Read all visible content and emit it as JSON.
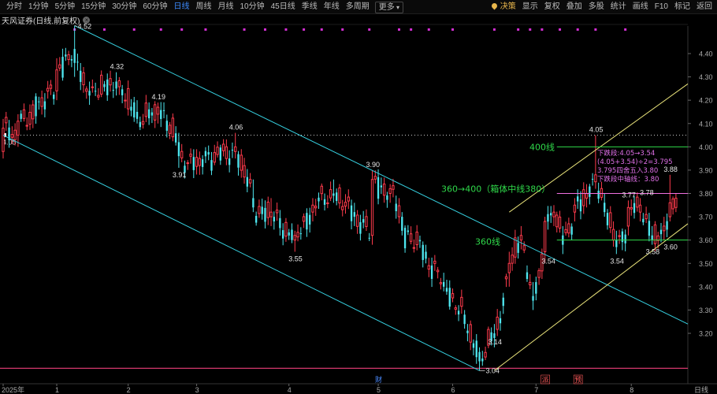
{
  "toolbar": {
    "periods": [
      "分时",
      "1分钟",
      "5分钟",
      "15分钟",
      "30分钟",
      "60分钟",
      "日线",
      "周线",
      "月线",
      "10分钟",
      "45日线",
      "季线",
      "年线",
      "多周期"
    ],
    "active_period": "日线",
    "more_label": "更多",
    "more_icon": "chevron-down-icon",
    "tools": [
      "决策",
      "显示",
      "复权",
      "叠加",
      "多股",
      "统计",
      "画线",
      "F10",
      "标记",
      "返回"
    ],
    "accent_color": "#e8b64c",
    "active_color": "#3d8bff"
  },
  "stock_title": "天风证券(日线,前复权)",
  "chart_data": {
    "type": "candlestick",
    "title": "天风证券(日线,前复权)",
    "ylim": [
      3.04,
      4.5
    ],
    "y_ticks": [
      4.4,
      4.3,
      4.2,
      4.1,
      4.0,
      3.9,
      3.8,
      3.7,
      3.6,
      3.5,
      3.4,
      3.3,
      3.2
    ],
    "x_ticks": [
      {
        "label": "2025年",
        "day": 0
      },
      {
        "label": "1",
        "day": 18
      },
      {
        "label": "2",
        "day": 42
      },
      {
        "label": "3",
        "day": 65
      },
      {
        "label": "4",
        "day": 96
      },
      {
        "label": "5",
        "day": 126
      },
      {
        "label": "6",
        "day": 151
      },
      {
        "label": "7",
        "day": 179
      },
      {
        "label": "8",
        "day": 211
      }
    ],
    "x_range_days": [
      0,
      230
    ],
    "right_axis_label": "日线",
    "up_color": "#ff3b4c",
    "down_color": "#4ee6ef",
    "anchors": [
      {
        "day": 0,
        "open": 3.98,
        "high": 4.12,
        "low": 3.95,
        "close": 4.08
      },
      {
        "day": 5,
        "open": 4.05,
        "high": 4.14,
        "low": 4.0,
        "close": 4.11
      },
      {
        "day": 10,
        "open": 4.12,
        "high": 4.2,
        "low": 4.08,
        "close": 4.18
      },
      {
        "day": 18,
        "open": 4.24,
        "high": 4.38,
        "low": 4.2,
        "close": 4.33
      },
      {
        "day": 24,
        "open": 4.42,
        "high": 4.52,
        "low": 4.3,
        "close": 4.36
      },
      {
        "day": 29,
        "open": 4.24,
        "high": 4.28,
        "low": 4.18,
        "close": 4.22
      },
      {
        "day": 38,
        "open": 4.28,
        "high": 4.32,
        "low": 4.22,
        "close": 4.25
      },
      {
        "day": 45,
        "open": 4.15,
        "high": 4.2,
        "low": 4.1,
        "close": 4.12
      },
      {
        "day": 52,
        "open": 4.14,
        "high": 4.19,
        "low": 4.1,
        "close": 4.17
      },
      {
        "day": 59,
        "open": 4.02,
        "high": 4.06,
        "low": 3.91,
        "close": 3.96
      },
      {
        "day": 66,
        "open": 3.92,
        "high": 3.98,
        "low": 3.88,
        "close": 3.95
      },
      {
        "day": 78,
        "open": 3.98,
        "high": 4.06,
        "low": 3.95,
        "close": 4.0
      },
      {
        "day": 84,
        "open": 3.78,
        "high": 3.86,
        "low": 3.72,
        "close": 3.74
      },
      {
        "day": 90,
        "open": 3.7,
        "high": 3.78,
        "low": 3.66,
        "close": 3.72
      },
      {
        "day": 98,
        "open": 3.6,
        "high": 3.64,
        "low": 3.55,
        "close": 3.62
      },
      {
        "day": 104,
        "open": 3.72,
        "high": 3.78,
        "low": 3.68,
        "close": 3.75
      },
      {
        "day": 111,
        "open": 3.8,
        "high": 3.86,
        "low": 3.76,
        "close": 3.79
      },
      {
        "day": 118,
        "open": 3.72,
        "high": 3.76,
        "low": 3.66,
        "close": 3.7
      },
      {
        "day": 124,
        "open": 3.62,
        "high": 3.9,
        "low": 3.58,
        "close": 3.86
      },
      {
        "day": 130,
        "open": 3.8,
        "high": 3.84,
        "low": 3.76,
        "close": 3.82
      },
      {
        "day": 134,
        "open": 3.7,
        "high": 3.72,
        "low": 3.62,
        "close": 3.64
      },
      {
        "day": 142,
        "open": 3.55,
        "high": 3.58,
        "low": 3.5,
        "close": 3.52
      },
      {
        "day": 148,
        "open": 3.42,
        "high": 3.46,
        "low": 3.38,
        "close": 3.4
      },
      {
        "day": 155,
        "open": 3.28,
        "high": 3.3,
        "low": 3.22,
        "close": 3.24
      },
      {
        "day": 160,
        "open": 3.12,
        "high": 3.14,
        "low": 3.04,
        "close": 3.08
      },
      {
        "day": 165,
        "open": 3.2,
        "high": 3.24,
        "low": 3.14,
        "close": 3.18
      },
      {
        "day": 170,
        "open": 3.46,
        "high": 3.55,
        "low": 3.4,
        "close": 3.5
      },
      {
        "day": 174,
        "open": 3.6,
        "high": 3.66,
        "low": 3.56,
        "close": 3.62
      },
      {
        "day": 178,
        "open": 3.36,
        "high": 3.42,
        "low": 3.3,
        "close": 3.34
      },
      {
        "day": 182,
        "open": 3.55,
        "high": 3.7,
        "low": 3.5,
        "close": 3.68
      },
      {
        "day": 185,
        "open": 3.7,
        "high": 3.75,
        "low": 3.66,
        "close": 3.72
      },
      {
        "day": 188,
        "open": 3.62,
        "high": 3.66,
        "low": 3.54,
        "close": 3.58
      },
      {
        "day": 192,
        "open": 3.72,
        "high": 3.78,
        "low": 3.68,
        "close": 3.75
      },
      {
        "day": 196,
        "open": 3.78,
        "high": 3.84,
        "low": 3.74,
        "close": 3.8
      },
      {
        "day": 199,
        "open": 3.85,
        "high": 4.05,
        "low": 3.82,
        "close": 3.88
      },
      {
        "day": 202,
        "open": 3.76,
        "high": 3.8,
        "low": 3.7,
        "close": 3.72
      },
      {
        "day": 206,
        "open": 3.6,
        "high": 3.64,
        "low": 3.54,
        "close": 3.57
      },
      {
        "day": 210,
        "open": 3.66,
        "high": 3.77,
        "low": 3.62,
        "close": 3.74
      },
      {
        "day": 214,
        "open": 3.72,
        "high": 3.78,
        "low": 3.68,
        "close": 3.75
      },
      {
        "day": 218,
        "open": 3.62,
        "high": 3.66,
        "low": 3.58,
        "close": 3.6
      },
      {
        "day": 222,
        "open": 3.64,
        "high": 3.7,
        "low": 3.6,
        "close": 3.66
      },
      {
        "day": 224,
        "open": 3.7,
        "high": 3.88,
        "low": 3.68,
        "close": 3.76
      },
      {
        "day": 226,
        "open": 3.74,
        "high": 3.8,
        "low": 3.72,
        "close": 3.78
      }
    ],
    "price_labels": [
      {
        "text": "4.52",
        "day": 24,
        "price": 4.52,
        "pos": "above-right"
      },
      {
        "text": "4.32",
        "day": 38,
        "price": 4.32,
        "pos": "above"
      },
      {
        "text": "4.19",
        "day": 52,
        "price": 4.19,
        "pos": "above"
      },
      {
        "text": "4.06",
        "day": 78,
        "price": 4.06,
        "pos": "above"
      },
      {
        "text": "3.91",
        "day": 59,
        "price": 3.91,
        "pos": "below"
      },
      {
        "text": "3.55",
        "day": 98,
        "price": 3.55,
        "pos": "below"
      },
      {
        "text": "3.90",
        "day": 124,
        "price": 3.9,
        "pos": "above"
      },
      {
        "text": "3.04",
        "day": 160,
        "price": 3.04,
        "pos": "right"
      },
      {
        "text": "3.14",
        "day": 165,
        "price": 3.14,
        "pos": "above"
      },
      {
        "text": "3.54",
        "day": 183,
        "price": 3.54,
        "pos": "below"
      },
      {
        "text": "4.05",
        "day": 199,
        "price": 4.05,
        "pos": "above"
      },
      {
        "text": "3.54",
        "day": 206,
        "price": 3.54,
        "pos": "below"
      },
      {
        "text": "3.77",
        "day": 210,
        "price": 3.77,
        "pos": "above"
      },
      {
        "text": "3.78",
        "day": 216,
        "price": 3.78,
        "pos": "above"
      },
      {
        "text": "3.58",
        "day": 218,
        "price": 3.58,
        "pos": "below"
      },
      {
        "text": "3.60",
        "day": 224,
        "price": 3.6,
        "pos": "below"
      },
      {
        "text": "3.88",
        "day": 224,
        "price": 3.88,
        "pos": "above"
      }
    ],
    "dotted_line": {
      "price": 4.05,
      "text": "4.05",
      "color": "#cccccc"
    },
    "bottom_line": {
      "price": 3.05,
      "color": "#d4386c"
    },
    "down_channel": {
      "color": "#36d0e0",
      "upper": [
        {
          "day": 24,
          "price": 4.52
        },
        {
          "day": 230,
          "price": 3.24
        }
      ],
      "lower": [
        {
          "day": 0,
          "price": 4.05
        },
        {
          "day": 160,
          "price": 3.04
        }
      ]
    },
    "up_channel": {
      "color": "#e8e27a",
      "upper": [
        {
          "day": 170,
          "price": 3.72
        },
        {
          "day": 230,
          "price": 4.27
        }
      ],
      "lower": [
        {
          "day": 165,
          "price": 3.04
        },
        {
          "day": 230,
          "price": 3.67
        }
      ]
    },
    "levels": [
      {
        "price": 4.0,
        "label": "400线",
        "color": "#2fd94a"
      },
      {
        "price": 3.8,
        "label": "360→400（箱体中线380）",
        "color": "#f070e0"
      },
      {
        "price": 3.6,
        "label": "360线",
        "color": "#2fd94a"
      }
    ],
    "level_label_color": "#2fd94a",
    "annotation": {
      "color": "#e070e8",
      "lines": [
        "下跌段:4.05→3.54",
        "(4.05+3.54)÷2=3.795",
        "3.795四舍五入3.80",
        "下跌段中轴线：3.80"
      ]
    },
    "markers": [
      {
        "text": "财",
        "day": 126,
        "color": "#4b8bff"
      },
      {
        "text": "派",
        "day": 182,
        "color": "#ff5a5a"
      },
      {
        "text": "预",
        "day": 193,
        "color": "#ff5a5a"
      }
    ],
    "magenta_dots_days": [
      24,
      34,
      44,
      53,
      60,
      68,
      81,
      88,
      95,
      101,
      107,
      114,
      123,
      133,
      137,
      143,
      151,
      165,
      173,
      177,
      181,
      187,
      193,
      199,
      209
    ]
  }
}
